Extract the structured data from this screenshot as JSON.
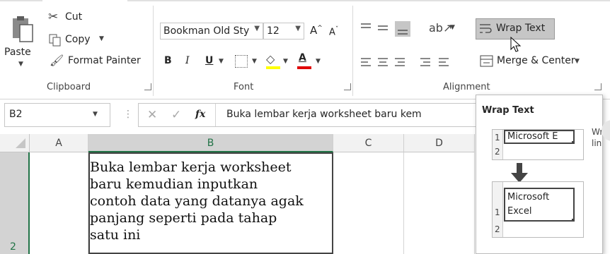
{
  "ribbon": {
    "clipboard": {
      "paste_label": "Paste",
      "cut_label": "Cut",
      "copy_label": "Copy",
      "format_painter_label": "Format Painter",
      "group_label": "Clipboard"
    },
    "font": {
      "font_name": "Bookman Old Sty",
      "font_size": "12",
      "bold": "B",
      "italic": "I",
      "underline": "U",
      "grow_glyph": "A",
      "shrink_glyph": "A",
      "font_color_glyph": "A",
      "group_label": "Font"
    },
    "alignment": {
      "wrap_text_label": "Wrap Text",
      "merge_center_label": "Merge & Center",
      "group_label": "Alignment"
    }
  },
  "formula_bar": {
    "name_box": "B2",
    "fx_label": "fx",
    "content": "Buka lembar kerja worksheet baru kem"
  },
  "grid": {
    "columns": [
      "A",
      "B",
      "C",
      "D"
    ],
    "rows": [
      "2"
    ],
    "cell_b2": "Buka lembar kerja worksheet\nbaru kemudian inputkan\ncontoh data yang datanya agak\npanjang seperti pada tahap\nsatu ini"
  },
  "tooltip": {
    "title": "Wrap Text",
    "before_row1": "1",
    "before_row2": "2",
    "before_cell": "Microsoft E",
    "after_row1": "1",
    "after_row2": "2",
    "after_line1": "Microsoft",
    "after_line2": "Excel",
    "side_text_1": "Wr",
    "side_text_2": "lin"
  },
  "colors": {
    "accent_green": "#217346",
    "selected_button_bg": "#c6c6c6"
  }
}
